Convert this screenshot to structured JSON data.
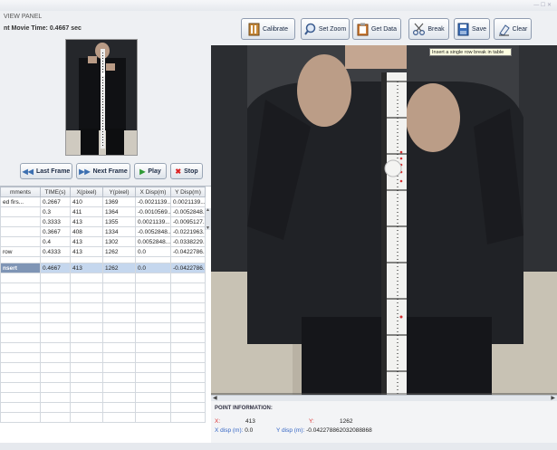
{
  "preview_panel": {
    "heading": "VIEW PANEL",
    "movie_time_label": "nt Movie Time:",
    "movie_time_value": "0.4667 sec"
  },
  "controls": {
    "last_frame": "Last Frame",
    "next_frame": "Next Frame",
    "play": "Play",
    "stop": "Stop"
  },
  "table": {
    "columns": [
      "mments",
      "TIME(s)",
      "X(pixel)",
      "Y(pixel)",
      "X Disp(m)",
      "Y Disp(m)"
    ],
    "rows": [
      [
        "ed firs...",
        "0.2667",
        "410",
        "1369",
        "-0.0021139...",
        "0.0021139..."
      ],
      [
        "",
        "0.3",
        "411",
        "1364",
        "-0.0010569...",
        "-0.0052848..."
      ],
      [
        "",
        "0.3333",
        "413",
        "1355",
        "0.0021139...",
        "-0.0095127..."
      ],
      [
        "",
        "0.3667",
        "408",
        "1334",
        "-0.0052848...",
        "-0.0221963..."
      ],
      [
        "",
        "0.4",
        "413",
        "1302",
        "0.0052848...",
        "-0.0338229..."
      ],
      [
        "row",
        "0.4333",
        "413",
        "1262",
        "0.0",
        "-0.0422786..."
      ]
    ],
    "selected_row": [
      "nsert",
      "0.4667",
      "413",
      "1262",
      "0.0",
      "-0.0422786..."
    ]
  },
  "toolbar": {
    "calibrate": "Calibrate",
    "set_zoom": "Set Zoom",
    "get_data": "Get Data",
    "break": "Break",
    "save": "Save",
    "clear": "Clear",
    "tooltip": "Insert a single row break in table"
  },
  "point_info": {
    "heading": "POINT INFORMATION:",
    "x_label": "X:",
    "x_value": "413",
    "y_label": "Y:",
    "y_value": "1262",
    "xdisp_label": "X disp (m):",
    "xdisp_value": "0.0",
    "ydisp_label": "Y disp (m):",
    "ydisp_value": "-0.042278862032088868"
  },
  "icons": {
    "last_frame": "rewind-icon",
    "next_frame": "fast-forward-icon",
    "play": "play-icon",
    "stop": "stop-icon",
    "calibrate": "calibrate-icon",
    "set_zoom": "magnifier-icon",
    "get_data": "clipboard-icon",
    "break": "scissors-icon",
    "save": "floppy-disk-icon",
    "clear": "eraser-icon"
  },
  "colors": {
    "selected_row": "#c5d7ee",
    "point_label": "#d33333",
    "disp_label": "#3465c4",
    "tooltip_bg": "#ffffe1"
  }
}
